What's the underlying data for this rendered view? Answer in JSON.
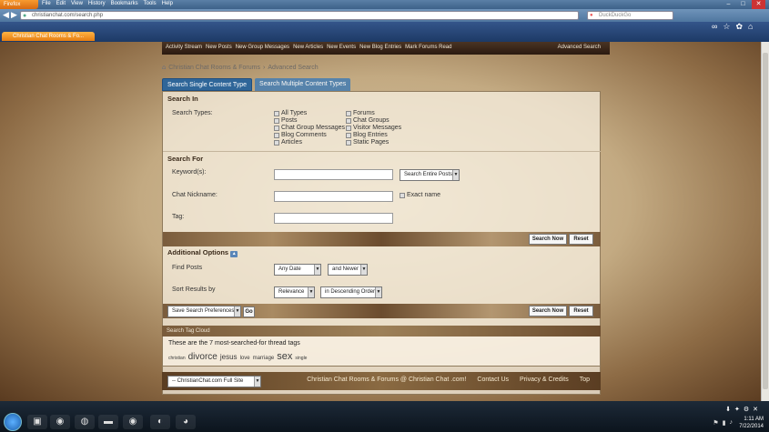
{
  "browser": {
    "app_button": "Firefox",
    "menu": [
      "File",
      "Edit",
      "View",
      "History",
      "Bookmarks",
      "Tools",
      "Help"
    ],
    "url": "christianchat.com/search.php",
    "search_placeholder": "DuckDuckGo",
    "tab_title": "Christian Chat Rooms & Fo..."
  },
  "topnav": {
    "items": [
      "Activity Stream",
      "New Posts",
      "New Group Messages",
      "New Articles",
      "New Events",
      "New Blog Entries",
      "Mark Forums Read"
    ],
    "advanced": "Advanced Search"
  },
  "breadcrumb": {
    "home": "Christian Chat Rooms & Forums",
    "current": "Advanced Search"
  },
  "tabs": {
    "single": "Search Single Content Type",
    "multiple": "Search Multiple Content Types"
  },
  "search_in": {
    "heading": "Search In",
    "types_label": "Search Types:",
    "col1": [
      "All Types",
      "Posts",
      "Chat Group Messages",
      "Blog Comments",
      "Articles"
    ],
    "col2": [
      "Forums",
      "Chat Groups",
      "Visitor Messages",
      "Blog Entries",
      "Static Pages"
    ]
  },
  "search_for": {
    "heading": "Search For",
    "keywords_label": "Keyword(s):",
    "keyword_scope": "Search Entire Posts",
    "nickname_label": "Chat Nickname:",
    "exact_name": "Exact name",
    "tag_label": "Tag:"
  },
  "buttons": {
    "search_now": "Search Now",
    "reset": "Reset",
    "go": "Go"
  },
  "additional": {
    "heading": "Additional Options",
    "find_posts_label": "Find Posts",
    "date": "Any Date",
    "date_dir": "and Newer",
    "sort_label": "Sort Results by",
    "sort": "Relevance",
    "order": "in Descending Order",
    "prefs": "Save Search Preferences"
  },
  "tag_cloud": {
    "header": "Search Tag Cloud",
    "desc": "These are the 7 most-searched-for thread tags",
    "tags": [
      "christian",
      "divorce",
      "jesus",
      "love",
      "marriage",
      "sex",
      "single"
    ]
  },
  "footer": {
    "site_select": "-- ChristianChat.com Full Site",
    "links": [
      "Christian Chat Rooms & Forums @ Christian Chat .com!",
      "Contact Us",
      "Privacy & Credits",
      "Top"
    ]
  },
  "taskbar": {
    "time": "1:11 AM",
    "date": "7/22/2014"
  }
}
